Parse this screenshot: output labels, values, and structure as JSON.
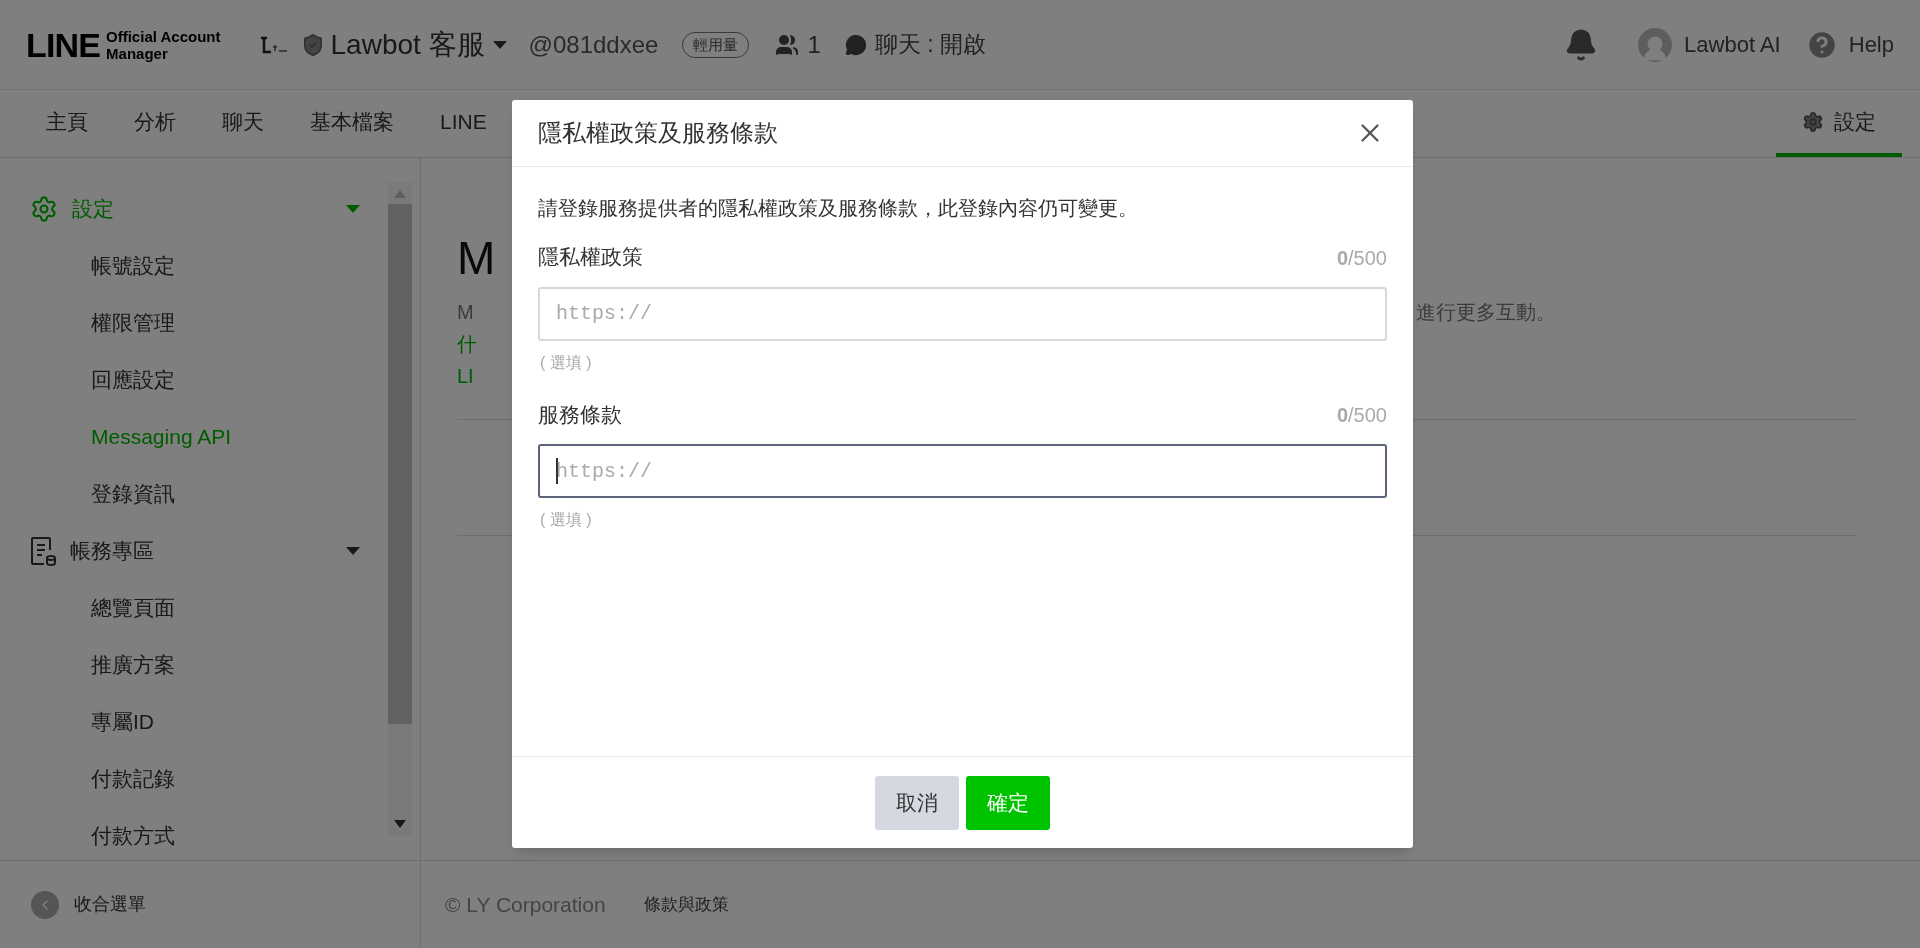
{
  "header": {
    "logo": {
      "word": "LINE",
      "sub": [
        "Official Account",
        "Manager"
      ]
    },
    "account_name": "Lawbot 客服",
    "account_id": "@081ddxee",
    "plan_badge": "輕用量",
    "member_count": "1",
    "chat_status": "聊天 : 開啟",
    "user_name": "Lawbot AI",
    "help": "Help"
  },
  "nav": {
    "tabs": [
      {
        "label": "主頁",
        "selected": false
      },
      {
        "label": "分析",
        "selected": false
      },
      {
        "label": "聊天",
        "selected": false
      },
      {
        "label": "基本檔案",
        "selected": false
      },
      {
        "label": "LINE",
        "selected": false
      }
    ],
    "settings_tab": {
      "label": "設定",
      "selected": true
    }
  },
  "sidebar": {
    "groups": [
      {
        "kind": "settings",
        "label": "設定",
        "expanded": true,
        "selected": true,
        "children": [
          {
            "label": "帳號設定",
            "selected": false
          },
          {
            "label": "權限管理",
            "selected": false
          },
          {
            "label": "回應設定",
            "selected": false
          },
          {
            "label": "Messaging API",
            "selected": true
          },
          {
            "label": "登錄資訊",
            "selected": false
          }
        ]
      },
      {
        "kind": "billing",
        "label": "帳務專區",
        "expanded": true,
        "selected": false,
        "children": [
          {
            "label": "總覽頁面",
            "selected": false
          },
          {
            "label": "推廣方案",
            "selected": false
          },
          {
            "label": "專屬ID",
            "selected": false
          },
          {
            "label": "付款記錄",
            "selected": false
          },
          {
            "label": "付款方式",
            "selected": false
          }
        ]
      }
    ],
    "collapse": "收合選單"
  },
  "main": {
    "heading": "M",
    "description_start": "M",
    "description_end": "進行更多互動。",
    "links": [
      "什",
      "LI"
    ]
  },
  "footer": {
    "copyright": "© LY Corporation",
    "terms": "條款與政策"
  },
  "dialog": {
    "title": "隱私權政策及服務條款",
    "intro": "請登錄服務提供者的隱私權政策及服務條款，此登錄內容仍可變更。",
    "fields": [
      {
        "label": "隱私權政策",
        "counter": "**0**/500",
        "placeholder": "https://",
        "hint": "( 選填 )",
        "focused": false
      },
      {
        "label": "服務條款",
        "counter": "**0**/500",
        "placeholder": "https://",
        "hint": "( 選填 )",
        "focused": true
      }
    ],
    "buttons": [
      {
        "kind": "secondary",
        "label": "取消"
      },
      {
        "kind": "primary",
        "label": "確定"
      }
    ]
  }
}
